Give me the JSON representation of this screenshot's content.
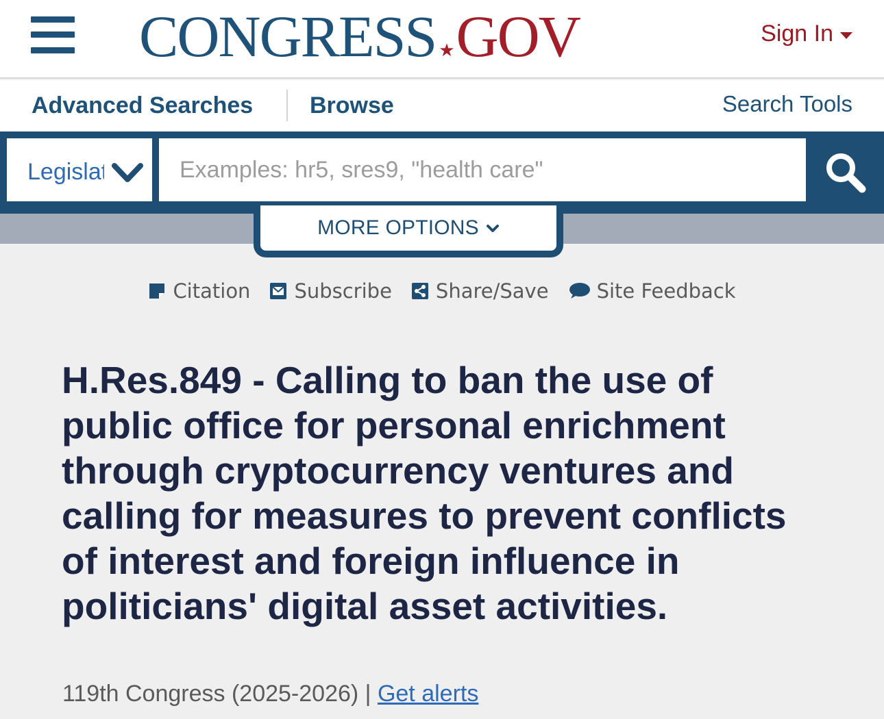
{
  "header": {
    "logo_congress": "CONGRESS",
    "logo_star": "★",
    "logo_gov": "GOV",
    "signin_label": "Sign In"
  },
  "nav": {
    "advanced_searches": "Advanced Searches",
    "browse": "Browse",
    "search_tools": "Search Tools"
  },
  "search": {
    "collection_selected": "Legislation",
    "placeholder": "Examples: hr5, sres9, \"health care\"",
    "value": "",
    "more_options": "MORE OPTIONS"
  },
  "tools": [
    {
      "label": "Citation",
      "icon": "citation-icon"
    },
    {
      "label": "Subscribe",
      "icon": "mail-icon"
    },
    {
      "label": "Share/Save",
      "icon": "share-icon"
    },
    {
      "label": "Site Feedback",
      "icon": "comment-icon"
    }
  ],
  "bill": {
    "title": "H.Res.849 - Calling to ban the use of public office for personal enrichment through cryptocurrency ventures and calling for measures to prevent conflicts of interest and foreign influence in politicians' digital asset activities.",
    "congress": "119th Congress (2025-2026)",
    "separator": " | ",
    "alerts_link": "Get alerts"
  },
  "colors": {
    "brand_blue": "#1f5278",
    "brand_red": "#a21f2a",
    "search_band": "#1f4e74",
    "title_text": "#1d2644",
    "link": "#2d6bb8"
  }
}
